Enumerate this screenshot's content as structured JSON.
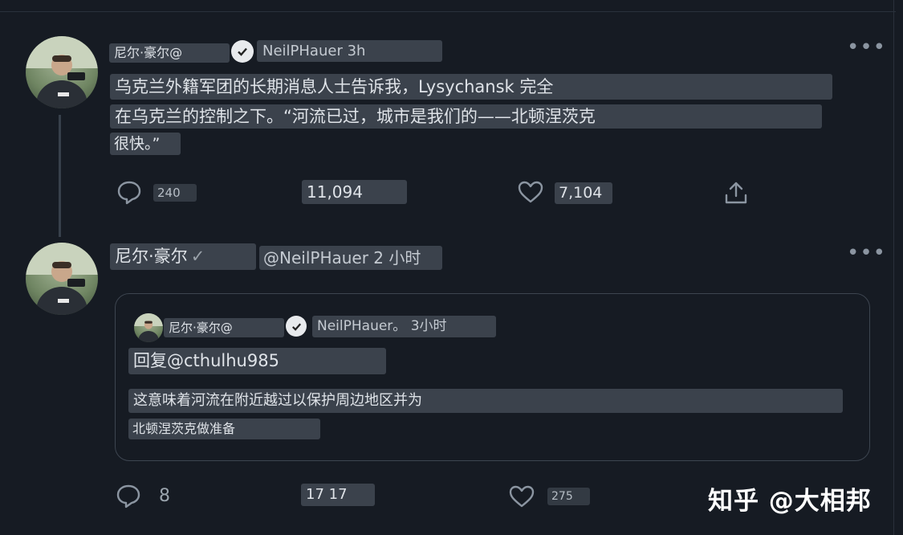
{
  "tweet1": {
    "display_name": "尼尔·豪尔@",
    "handle_time": "NeilPHauer 3h",
    "text_line1": "乌克兰外籍军团的长期消息人士告诉我，Lysychansk 完全",
    "text_line2": "在乌克兰的控制之下。“河流已过，城市是我们的——北顿涅茨克",
    "text_line3": "很快。”",
    "reply_count": "240",
    "retweet_count": "11,094",
    "like_count": "7,104"
  },
  "tweet2": {
    "display_name": "尼尔·豪尔",
    "verified_mark": "✓",
    "handle_time": "@NeilPHauer 2 小时",
    "reply_count": "8",
    "retweet_count": "17 17",
    "like_count": "275"
  },
  "quoted": {
    "display_name": "尼尔·豪尔@",
    "handle_time": "NeilPHauer。 3小时",
    "reply_to": "回复@cthulhu985",
    "text_line1": "这意味着河流在附近越过以保护周边地区并为",
    "text_line2": "北顿涅茨克做准备"
  },
  "more_glyph": "•••",
  "watermark": "知乎 @大相邦",
  "colors": {
    "background": "#161b23",
    "text_box": "#3b424c",
    "icon": "#8b95a1"
  },
  "icons": [
    "reply-icon",
    "retweet-icon",
    "like-icon",
    "share-icon",
    "verified-icon",
    "more-icon"
  ]
}
